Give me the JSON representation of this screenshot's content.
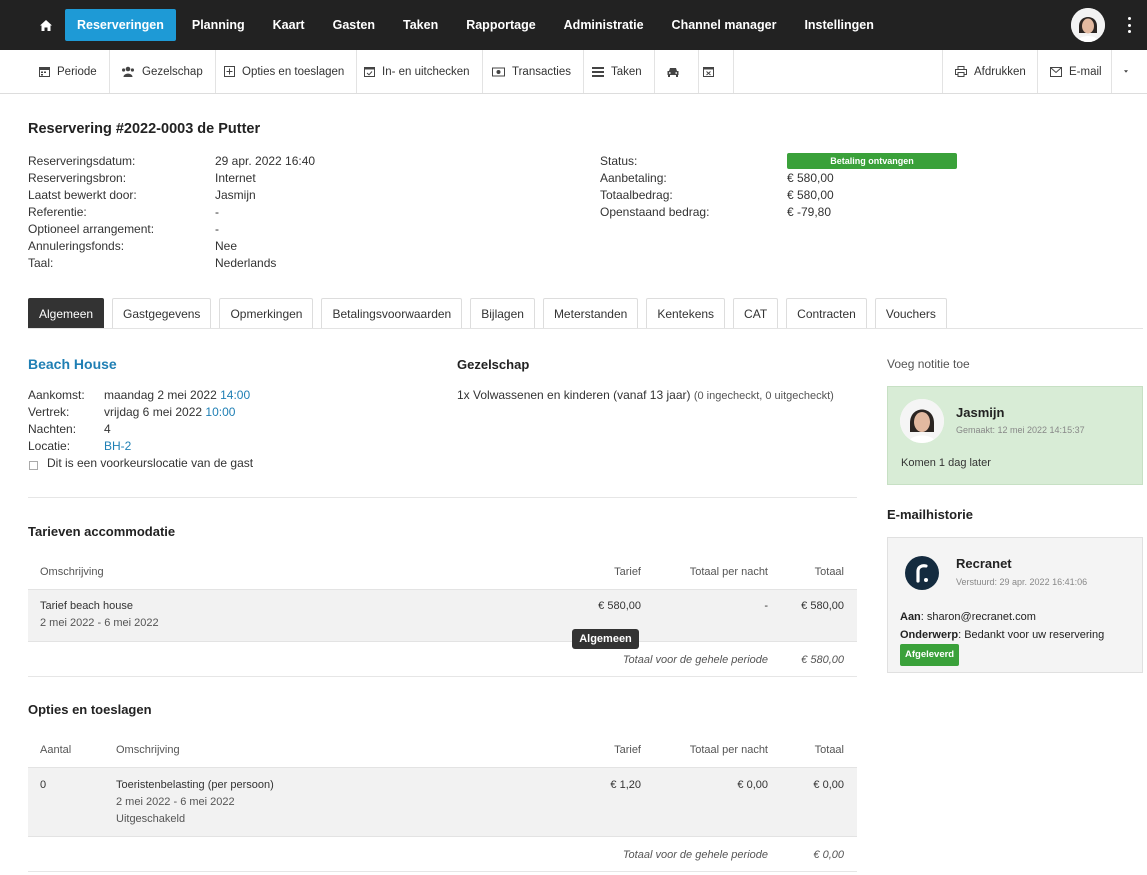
{
  "nav": {
    "items": [
      "Reserveringen",
      "Planning",
      "Kaart",
      "Gasten",
      "Taken",
      "Rapportage",
      "Administratie",
      "Channel manager",
      "Instellingen"
    ],
    "active": "Reserveringen",
    "accent": "#1e9ad6"
  },
  "toolbar": {
    "periode": "Periode",
    "gezelschap": "Gezelschap",
    "opties": "Opties en toeslagen",
    "inuit": "In- en uitchecken",
    "transacties": "Transacties",
    "taken": "Taken",
    "afdrukken": "Afdrukken",
    "email": "E-mail"
  },
  "reservation": {
    "title": "Reservering #2022-0003 de Putter",
    "left_labels": [
      "Reserveringsdatum:",
      "Reserveringsbron:",
      "Laatst bewerkt door:",
      "Referentie:",
      "Optioneel arrangement:",
      "Annuleringsfonds:",
      "Taal:"
    ],
    "left_values": [
      "29 apr. 2022 16:40",
      "Internet",
      "Jasmijn",
      "-",
      "-",
      "Nee",
      "Nederlands"
    ],
    "right_labels": [
      "Status:",
      "Aanbetaling:",
      "Totaalbedrag:",
      "Openstaand bedrag:"
    ],
    "status": "Betaling ontvangen",
    "right_values": [
      "€ 580,00",
      "€ 580,00",
      "€ -79,80"
    ]
  },
  "tabs": [
    "Algemeen",
    "Gastgegevens",
    "Opmerkingen",
    "Betalingsvoorwaarden",
    "Bijlagen",
    "Meterstanden",
    "Kentekens",
    "CAT",
    "Contracten",
    "Vouchers"
  ],
  "stay": {
    "accommodation": "Beach House",
    "aankomst_label": "Aankomst:",
    "aankomst_date": "maandag 2 mei 2022",
    "aankomst_time": "14:00",
    "vertrek_label": "Vertrek:",
    "vertrek_date": "vrijdag 6 mei 2022",
    "vertrek_time": "10:00",
    "nachten_label": "Nachten:",
    "nachten": "4",
    "locatie_label": "Locatie:",
    "locatie": "BH-2",
    "preference": "Dit is een voorkeurslocatie van de gast"
  },
  "gezelschap": {
    "title": "Gezelschap",
    "line": "1x Volwassenen en kinderen (vanaf 13 jaar)",
    "checkin": "(0 ingecheckt, 0 uitgecheckt)"
  },
  "tarieven": {
    "title": "Tarieven accommodatie",
    "headers": [
      "Omschrijving",
      "Tarief",
      "Totaal per nacht",
      "Totaal"
    ],
    "row": {
      "desc": "Tarief beach house",
      "period": "2 mei 2022 - 6 mei 2022",
      "tarief": "€ 580,00",
      "per_nacht": "-",
      "totaal": "€ 580,00"
    },
    "total_label": "Totaal voor de gehele periode",
    "total_value": "€ 580,00"
  },
  "tooltip": "Algemeen",
  "opties": {
    "title": "Opties en toeslagen",
    "headers": [
      "Aantal",
      "Omschrijving",
      "Tarief",
      "Totaal per nacht",
      "Totaal"
    ],
    "row": {
      "aantal": "0",
      "desc": "Toeristenbelasting (per persoon)",
      "period": "2 mei 2022 - 6 mei 2022",
      "status": "Uitgeschakeld",
      "tarief": "€ 1,20",
      "per_nacht": "€ 0,00",
      "totaal": "€ 0,00"
    },
    "total_label": "Totaal voor de gehele periode",
    "total_value": "€ 0,00"
  },
  "notes": {
    "add": "Voeg notitie toe",
    "author": "Jasmijn",
    "created": "Gemaakt: 12 mei 2022 14:15:37",
    "text": "Komen 1 dag later"
  },
  "mail": {
    "title": "E-mailhistorie",
    "sender": "Recranet",
    "sent": "Verstuurd: 29 apr. 2022 16:41:06",
    "aan_label": "Aan",
    "aan": ": sharon@recranet.com",
    "onderwerp_label": "Onderwerp",
    "onderwerp": ": Bedankt voor uw reservering",
    "status": "Afgeleverd"
  }
}
